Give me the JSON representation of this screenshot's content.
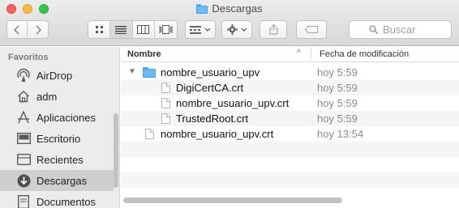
{
  "window": {
    "title": "Descargas"
  },
  "toolbar": {
    "back_icon": "chevron-left-icon",
    "forward_icon": "chevron-right-icon",
    "views": [
      "icon-view-icon",
      "list-view-icon",
      "column-view-icon",
      "gallery-view-icon"
    ],
    "active_view": 1,
    "search_placeholder": "Buscar"
  },
  "sidebar": {
    "heading": "Favoritos",
    "items": [
      {
        "label": "AirDrop",
        "icon": "airdrop-icon"
      },
      {
        "label": "adm",
        "icon": "home-icon"
      },
      {
        "label": "Aplicaciones",
        "icon": "applications-icon"
      },
      {
        "label": "Escritorio",
        "icon": "desktop-icon"
      },
      {
        "label": "Recientes",
        "icon": "recents-icon"
      },
      {
        "label": "Descargas",
        "icon": "downloads-icon",
        "selected": true
      },
      {
        "label": "Documentos",
        "icon": "documents-icon"
      }
    ]
  },
  "table": {
    "columns": [
      "Nombre",
      "Fecha de modificación"
    ],
    "sort_indicator": "^",
    "rows": [
      {
        "name": "nombre_usuario_upv",
        "date": "hoy 5:59",
        "kind": "folder",
        "expanded": true,
        "depth": 0
      },
      {
        "name": "DigiCertCA.crt",
        "date": "hoy 5:59",
        "kind": "file",
        "depth": 1
      },
      {
        "name": "nombre_usuario_upv.crt",
        "date": "hoy 5:59",
        "kind": "file",
        "depth": 1
      },
      {
        "name": "TrustedRoot.crt",
        "date": "hoy 5:59",
        "kind": "file",
        "depth": 1
      },
      {
        "name": "nombre_usuario_upv.crt",
        "date": "hoy 13:54",
        "kind": "file",
        "depth": 0
      }
    ]
  },
  "colors": {
    "folder": "#69b9f6",
    "selection": "#cfcfcf",
    "close": "#fc605c",
    "minimize": "#fdbc40",
    "maximize": "#34c84a"
  }
}
